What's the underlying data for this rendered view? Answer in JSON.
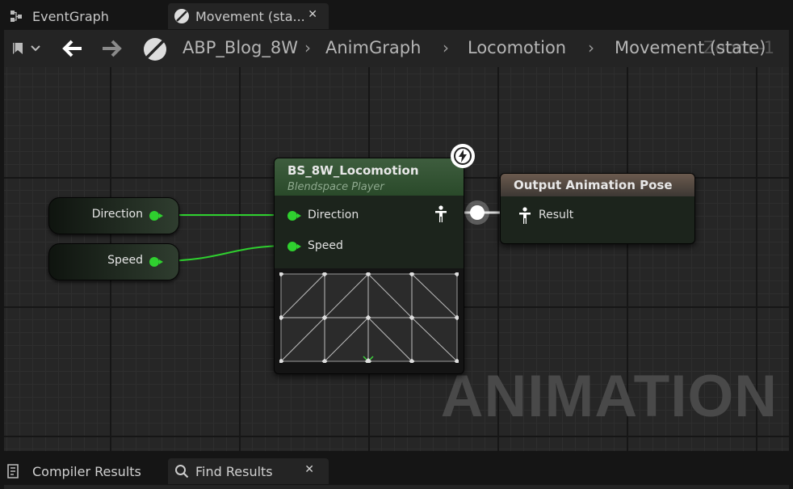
{
  "tabs": [
    {
      "label": "EventGraph",
      "icon": "event-graph-icon",
      "active": false
    },
    {
      "label": "Movement (sta...",
      "icon": "state-icon",
      "active": true,
      "close": "✕"
    }
  ],
  "breadcrumb": {
    "items": [
      "ABP_Blog_8W",
      "AnimGraph",
      "Locomotion",
      "Movement (state)"
    ],
    "separator": "›",
    "zoom": "Zoom -1"
  },
  "variables": [
    {
      "label": "Direction"
    },
    {
      "label": "Speed"
    }
  ],
  "blendspace_node": {
    "title": "BS_8W_Locomotion",
    "subtitle": "Blendspace Player",
    "pins": [
      "Direction",
      "Speed"
    ],
    "header_color": "#3e5d3e"
  },
  "output_node": {
    "title": "Output Animation Pose",
    "pin": "Result",
    "header_color": "#6b5a4e"
  },
  "watermark": "ANIMATION",
  "bottom_tabs": [
    {
      "label": "Compiler Results",
      "icon": "compiler-results-icon",
      "active": false
    },
    {
      "label": "Find Results",
      "icon": "search-icon",
      "active": true,
      "close": "✕"
    }
  ],
  "colors": {
    "pin_green": "#2fd02f",
    "canvas": "#262626"
  }
}
